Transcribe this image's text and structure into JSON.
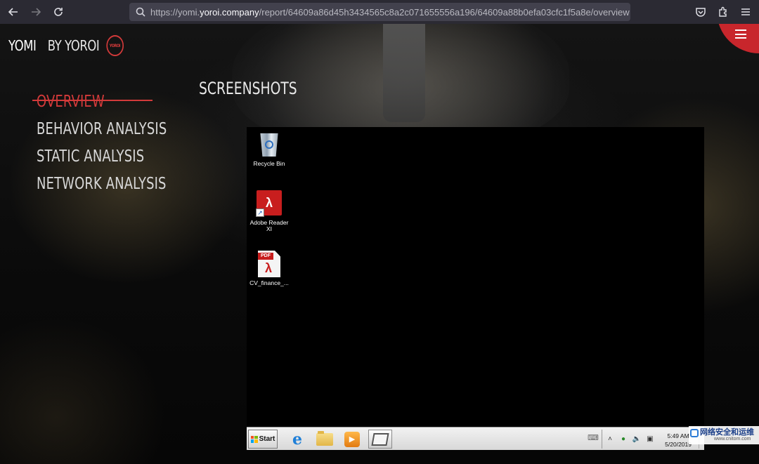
{
  "browser": {
    "url_prefix": "https://yomi.",
    "url_host": "yoroi.company",
    "url_path": "/report/64609a86d45h3434565c8a2c071655556a196/64609a88b0efa03cfc1f5a8e/overview",
    "icons": [
      "back-icon",
      "forward-icon",
      "reload-icon",
      "search-icon",
      "pocket-icon",
      "extensions-icon",
      "menu-icon"
    ]
  },
  "brand": {
    "name": "YOMI",
    "by": "BY YOROI",
    "logo_text": "YOROI",
    "accent_color": "#d33a3a"
  },
  "nav": {
    "items": [
      {
        "label": "OVERVIEW",
        "active": true
      },
      {
        "label": "BEHAVIOR ANALYSIS",
        "active": false
      },
      {
        "label": "STATIC ANALYSIS",
        "active": false
      },
      {
        "label": "NETWORK ANALYSIS",
        "active": false
      }
    ]
  },
  "section": {
    "title": "SCREENSHOTS"
  },
  "desktop": {
    "icons": [
      {
        "label": "Recycle Bin",
        "icon": "recycle-bin-icon"
      },
      {
        "label": "Adobe Reader XI",
        "icon": "adobe-reader-icon"
      },
      {
        "label": "CV_finance_...",
        "icon": "pdf-file-icon"
      }
    ],
    "taskbar": {
      "start_label": "Start",
      "apps": [
        "internet-explorer-icon",
        "file-explorer-icon",
        "media-player-icon",
        "program-window-icon"
      ],
      "clock_time": "5:49 AM",
      "clock_date": "5/20/2019"
    }
  },
  "watermark": {
    "title": "网络安全和运维",
    "url": "www.cnitom.com"
  }
}
